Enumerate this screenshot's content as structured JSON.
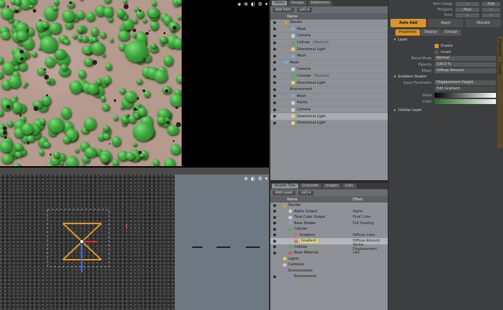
{
  "render_viewport": {
    "tools": [
      "◈",
      "⊕",
      "◐",
      "⚙",
      "▾"
    ]
  },
  "persp_viewport": {
    "tools": [
      "⊕",
      "◐",
      "⚙",
      "▾"
    ]
  },
  "items_panel": {
    "tabs": [
      "Items",
      "Groups",
      "Deformers"
    ],
    "toolbar": {
      "left": "Add Item",
      "right": "(all) ▾"
    },
    "column": "Name",
    "rows": [
      {
        "eye": "◉",
        "name": "Render",
        "indent": 0,
        "color": "#c9a13a"
      },
      {
        "eye": "◉",
        "name": "Mesh",
        "indent": 1,
        "color": "#7da6d6"
      },
      {
        "eye": "◉",
        "name": "Camera",
        "indent": 1,
        "color": "#cfcfcf"
      },
      {
        "eye": "◉",
        "name": "Cellular",
        "sub": "(Texture)",
        "indent": 1,
        "color": "#4fb04f"
      },
      {
        "eye": "◉",
        "name": "Directional Light",
        "indent": 1,
        "color": "#e8d06a"
      },
      {
        "eye": "◉",
        "name": "Mesh",
        "indent": 1,
        "color": "#7da6d6"
      },
      {
        "eye": "◉",
        "name": "Mesh",
        "indent": 0,
        "color": "#7da6d6"
      },
      {
        "eye": "◉",
        "name": "Camera",
        "indent": 1,
        "color": "#cfcfcf"
      },
      {
        "eye": "◉",
        "name": "Checker",
        "sub": "(Texture)",
        "indent": 1,
        "color": "#4fb04f"
      },
      {
        "eye": "◉",
        "name": "Directional Light",
        "indent": 1,
        "color": "#e8d06a"
      },
      {
        "eye": "◉",
        "name": "Environment",
        "indent": 0,
        "color": "#9a7fd0"
      },
      {
        "eye": "◉",
        "name": "Mesh",
        "indent": 1,
        "color": "#7da6d6"
      },
      {
        "eye": "◉",
        "name": "Points",
        "indent": 1,
        "color": "#cfcfcf"
      },
      {
        "eye": "◉",
        "name": "Camera",
        "indent": 1,
        "color": "#cfcfcf"
      },
      {
        "eye": "◉",
        "name": "Directional Light",
        "indent": 1,
        "color": "#e8d06a",
        "selected": true
      },
      {
        "eye": "◉",
        "name": "Directional Light",
        "indent": 1,
        "color": "#e8d06a"
      }
    ]
  },
  "shader_panel": {
    "tabs": [
      "Shader Tree",
      "Channels",
      "Images",
      "Lists"
    ],
    "toolbar": {
      "left": "Add Layer",
      "right": "(all) ▾"
    },
    "columns": {
      "name": "Name",
      "effect": "Effect"
    },
    "rows": [
      {
        "eye": "◉",
        "name": "Render",
        "effect": "",
        "color": "#c9a13a"
      },
      {
        "eye": "◉",
        "name": "Alpha Output",
        "effect": "Alpha",
        "color": "#cfcfcf"
      },
      {
        "eye": "◉",
        "name": "Final Color Output",
        "effect": "Final Color",
        "color": "#cfcfcf"
      },
      {
        "eye": "◉",
        "name": "Base Shader",
        "effect": "Full Shading",
        "color": "#7da6d6"
      },
      {
        "eye": "◉",
        "name": "Cellular",
        "effect": "",
        "color": "#4fb04f"
      },
      {
        "eye": "◉",
        "name": "Gradient",
        "effect": "Diffuse Color",
        "color": "#d07a3a"
      },
      {
        "eye": "◉",
        "name": "Gradient",
        "effect": "Diffuse Amount",
        "color": "#d07a3a",
        "selected": true
      },
      {
        "eye": "◉",
        "name": "Cellular",
        "effect": "Vector Displacement",
        "color": "#4fb04f"
      },
      {
        "eye": "◉",
        "name": "Base Material",
        "effect": "(all)",
        "color": "#c65b5b"
      },
      {
        "eye": "",
        "name": "Lights",
        "effect": "",
        "color": "#e8d06a"
      },
      {
        "eye": "",
        "name": "Cameras",
        "effect": "",
        "color": "#cfcfcf"
      },
      {
        "eye": "",
        "name": "Environments",
        "effect": "",
        "color": "#9a7fd0"
      },
      {
        "eye": "◉",
        "name": "Environment",
        "effect": "",
        "color": "#9a7fd0"
      }
    ]
  },
  "props_panel": {
    "top_fields": [
      {
        "label": "Item Usage",
        "value": "—",
        "extra": "Edit"
      },
      {
        "label": "Polygons",
        "value": "Face",
        "extra": "—"
      },
      {
        "label": "Point",
        "value": "—",
        "extra": "—"
      }
    ],
    "buttons": {
      "auto_add": "Auto Add",
      "apply": "Apply",
      "discard": "Discard"
    },
    "tabs": [
      "Properties",
      "Display",
      "Groups"
    ],
    "section_layer": "Layer",
    "enable_label": "Enable",
    "invert_label": "Invert",
    "blend_label": "Blend Mode",
    "blend_value": "Normal",
    "opacity_label": "Opacity",
    "opacity_value": "100.0 %",
    "effect_label": "Effect",
    "effect_value": "Diffuse Amount",
    "section_gradient": "Gradient Shader",
    "input_label": "Input Parameter",
    "input_value": "Displacement Height",
    "edit_gradient": "Edit Gradient",
    "value_label": "Value",
    "color_label": "Color",
    "section_cellular": "Cellular Layer",
    "strip_tabs": [
      "Properties",
      "Display"
    ]
  },
  "colors": {
    "accent": "#d7952a",
    "panel": "#8e9196"
  }
}
